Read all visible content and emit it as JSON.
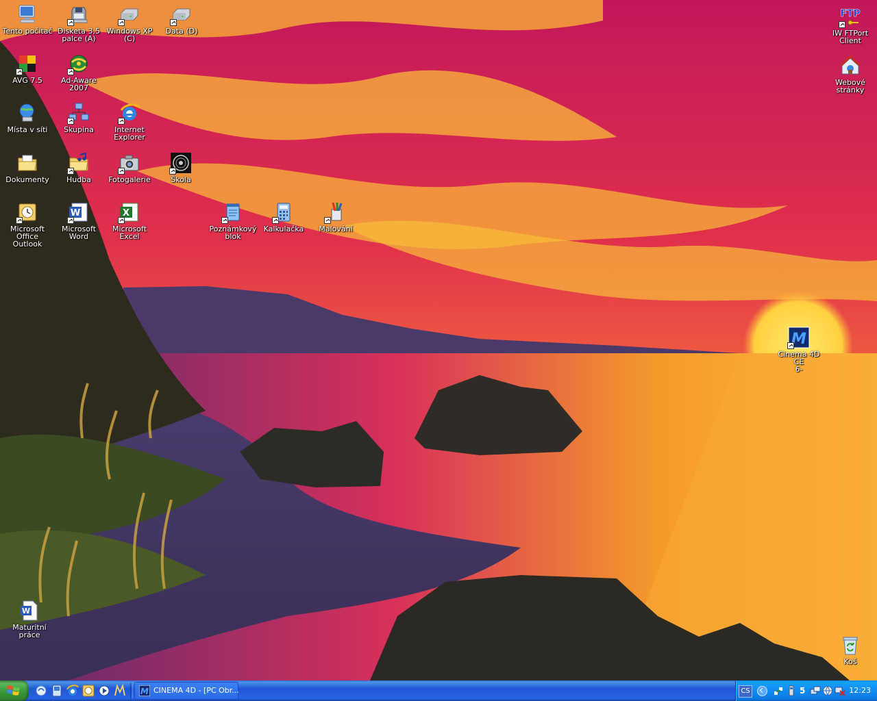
{
  "desktop": {
    "icons": [
      {
        "label": "Tento počítač",
        "icon": "my-computer-icon"
      },
      {
        "label": "Disketa 3,5\npalce (A)",
        "icon": "floppy-drive-icon"
      },
      {
        "label": "Windows XP\n(C)",
        "icon": "hard-drive-icon"
      },
      {
        "label": "Data (D)",
        "icon": "hard-drive-icon"
      },
      {
        "label": "AVG 7.5",
        "icon": "avg-antivirus-icon"
      },
      {
        "label": "Ad-Aware\n2007",
        "icon": "ad-aware-icon"
      },
      {
        "label": "Místa v síti",
        "icon": "network-places-icon"
      },
      {
        "label": "Skupina",
        "icon": "workgroup-icon"
      },
      {
        "label": "Internet\nExplorer",
        "icon": "internet-explorer-icon"
      },
      {
        "label": "Dokumenty",
        "icon": "documents-folder-icon"
      },
      {
        "label": "Hudba",
        "icon": "music-folder-icon"
      },
      {
        "label": "Fotogalerie",
        "icon": "camera-icon"
      },
      {
        "label": "Škola",
        "icon": "school-icon"
      },
      {
        "label": "Microsoft\nOffice Outlook",
        "icon": "outlook-icon"
      },
      {
        "label": "Microsoft\nWord",
        "icon": "word-icon"
      },
      {
        "label": "Microsoft\nExcel",
        "icon": "excel-icon"
      },
      {
        "label": "Poznámkový\nblok",
        "icon": "notepad-icon"
      },
      {
        "label": "Kalkulačka",
        "icon": "calculator-icon"
      },
      {
        "label": "Malování",
        "icon": "paint-icon"
      },
      {
        "label": "IW FTPort\nClient",
        "icon": "ftp-client-icon"
      },
      {
        "label": "Webové\nstránky",
        "icon": "web-folder-icon"
      },
      {
        "label": "Cinema 4D CE\n6-",
        "icon": "cinema4d-icon"
      },
      {
        "label": "Maturitní\npráce",
        "icon": "word-document-icon"
      },
      {
        "label": "Koš",
        "icon": "recycle-bin-icon"
      }
    ]
  },
  "taskbar": {
    "start_icon": "windows-logo-icon",
    "quick_launch": [
      "show-desktop-icon",
      "media-player-icon",
      "internet-explorer-icon",
      "outlook-icon",
      "media-icon",
      "cinema4d-icon"
    ],
    "task_button_label": "CINEMA 4D - [PC Obr...",
    "task_button_icon": "cinema4d-icon",
    "language": "CS",
    "tray_number": "5",
    "clock": "12:23"
  },
  "colors": {
    "taskbar_blue": "#2157d7",
    "start_green": "#379937",
    "tray_blue": "#0f8bef"
  }
}
